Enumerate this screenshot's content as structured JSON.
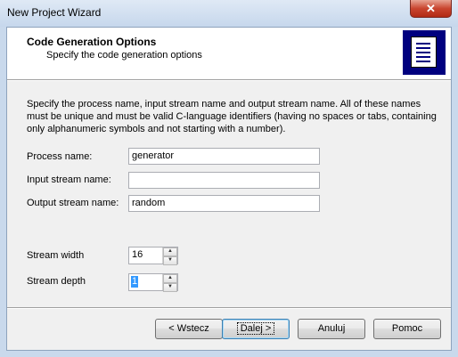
{
  "window": {
    "title": "New Project Wizard",
    "close_glyph": "✕"
  },
  "header": {
    "title": "Code Generation Options",
    "subtitle": "Specify the code generation options",
    "icon": "document-icon"
  },
  "description": "Specify the process name, input stream name and output stream name. All of these names must be unique and must be valid C-language identifiers (having no spaces or tabs, containing only alphanumeric symbols and not starting with a number).",
  "form": {
    "process_name": {
      "label": "Process name:",
      "value": "generator"
    },
    "input_stream_name": {
      "label": "Input stream name:",
      "value": ""
    },
    "output_stream_name": {
      "label": "Output stream name:",
      "value": "random"
    },
    "stream_width": {
      "label": "Stream width",
      "value": "16"
    },
    "stream_depth": {
      "label": "Stream depth",
      "value": "1"
    }
  },
  "buttons": {
    "back": "< Wstecz",
    "next": "Dalej >",
    "cancel": "Anuluj",
    "help": "Pomoc"
  }
}
